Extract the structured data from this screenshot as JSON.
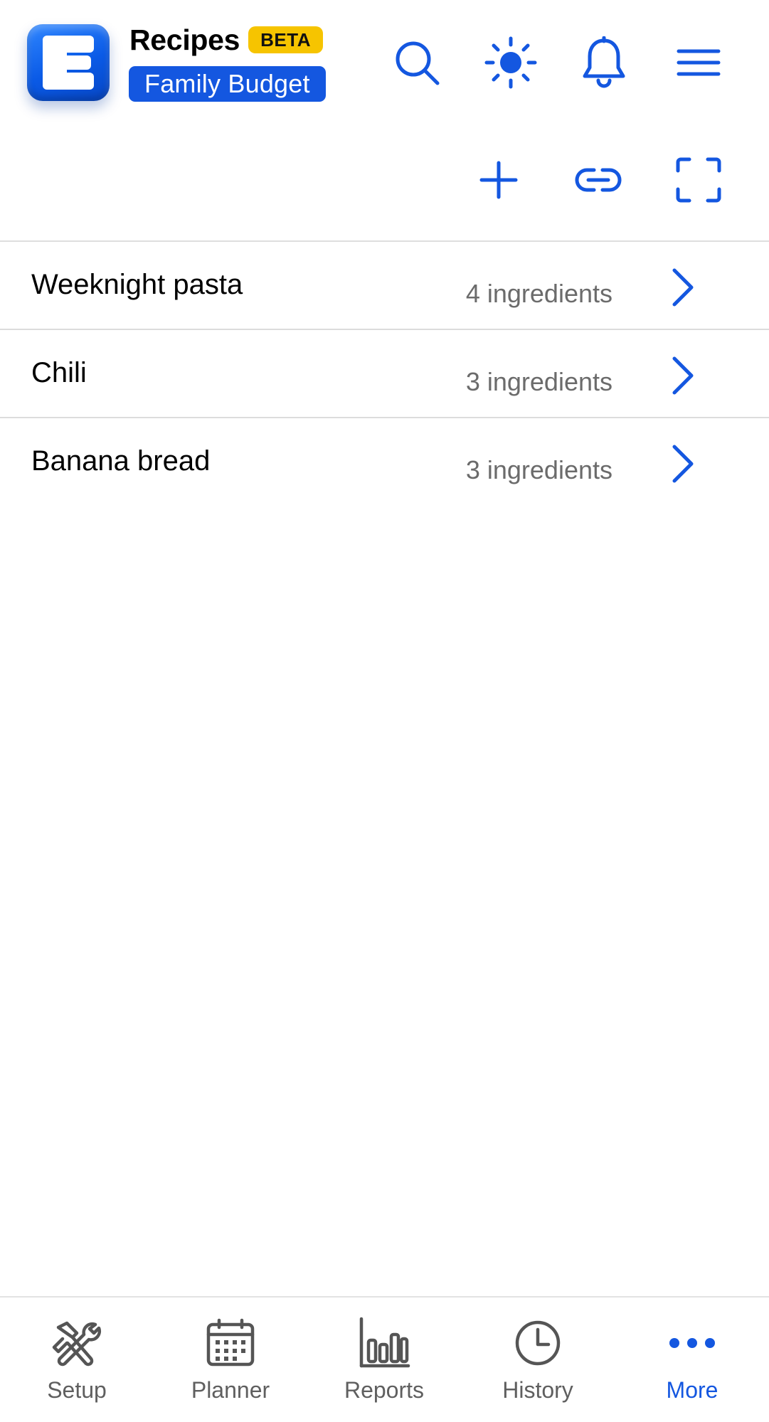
{
  "colors": {
    "accent": "#1457e0",
    "badge": "#f6c400",
    "muted": "#6b6b6b",
    "icon_gray": "#555555"
  },
  "header": {
    "title": "Recipes",
    "beta_badge": "BETA",
    "budget_name": "Family Budget",
    "icons": [
      "app-logo",
      "search-icon",
      "sun-icon",
      "bell-icon",
      "menu-icon"
    ]
  },
  "toolbar": {
    "icons": [
      "plus-icon",
      "link-icon",
      "fullscreen-icon"
    ]
  },
  "recipes": [
    {
      "name": "Weeknight pasta",
      "count": "4 ingredients"
    },
    {
      "name": "Chili",
      "count": "3 ingredients"
    },
    {
      "name": "Banana bread",
      "count": "3 ingredients"
    }
  ],
  "tabs": [
    {
      "label": "Setup",
      "icon": "tools-icon",
      "active": false
    },
    {
      "label": "Planner",
      "icon": "calendar-icon",
      "active": false
    },
    {
      "label": "Reports",
      "icon": "bar-chart-icon",
      "active": false
    },
    {
      "label": "History",
      "icon": "clock-icon",
      "active": false
    },
    {
      "label": "More",
      "icon": "more-dots-icon",
      "active": true
    }
  ]
}
